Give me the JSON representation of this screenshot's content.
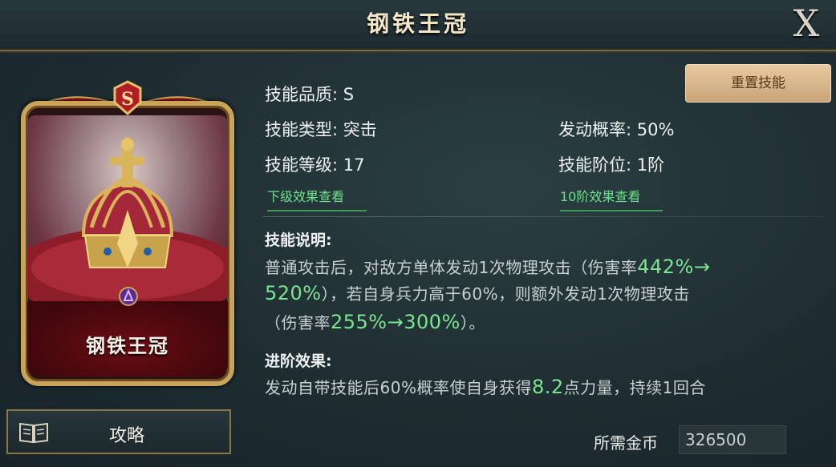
{
  "header": {
    "title": "钢铁王冠",
    "close_label": "X"
  },
  "card": {
    "name": "钢铁王冠",
    "quality_badge": "S"
  },
  "guide_button": {
    "label": "攻略"
  },
  "reset_button": {
    "label": "重置技能"
  },
  "stats": {
    "quality": "技能品质: S",
    "type": "技能类型: 突击",
    "level": "技能等级: 17",
    "trigger_rate": "发动概率: 50%",
    "rank": "技能阶位: 1阶",
    "next_level_link": "下级效果查看",
    "rank10_link": "10阶效果查看"
  },
  "description": {
    "title": "技能说明:",
    "line1_a": "普通攻击后，对敌方单体发动1次物理攻击（伤害率",
    "line1_hl": "442%→",
    "line2_hl": "520%",
    "line2_b": "），若自身兵力高于60%，则额外发动1次物理攻击",
    "line3_a": "（伤害率",
    "line3_hl": "255%→300%",
    "line3_b": "）。"
  },
  "advance": {
    "title": "进阶效果:",
    "line_a": "发动自带技能后60%概率使自身获得",
    "line_hl": "8.2",
    "line_b": "点力量，持续1回合"
  },
  "cost": {
    "label": "所需金币",
    "value": "326500"
  },
  "colors": {
    "highlight": "#7ce591",
    "gold_frame": "#c7a45a",
    "reset_button": "#d9b78a"
  }
}
